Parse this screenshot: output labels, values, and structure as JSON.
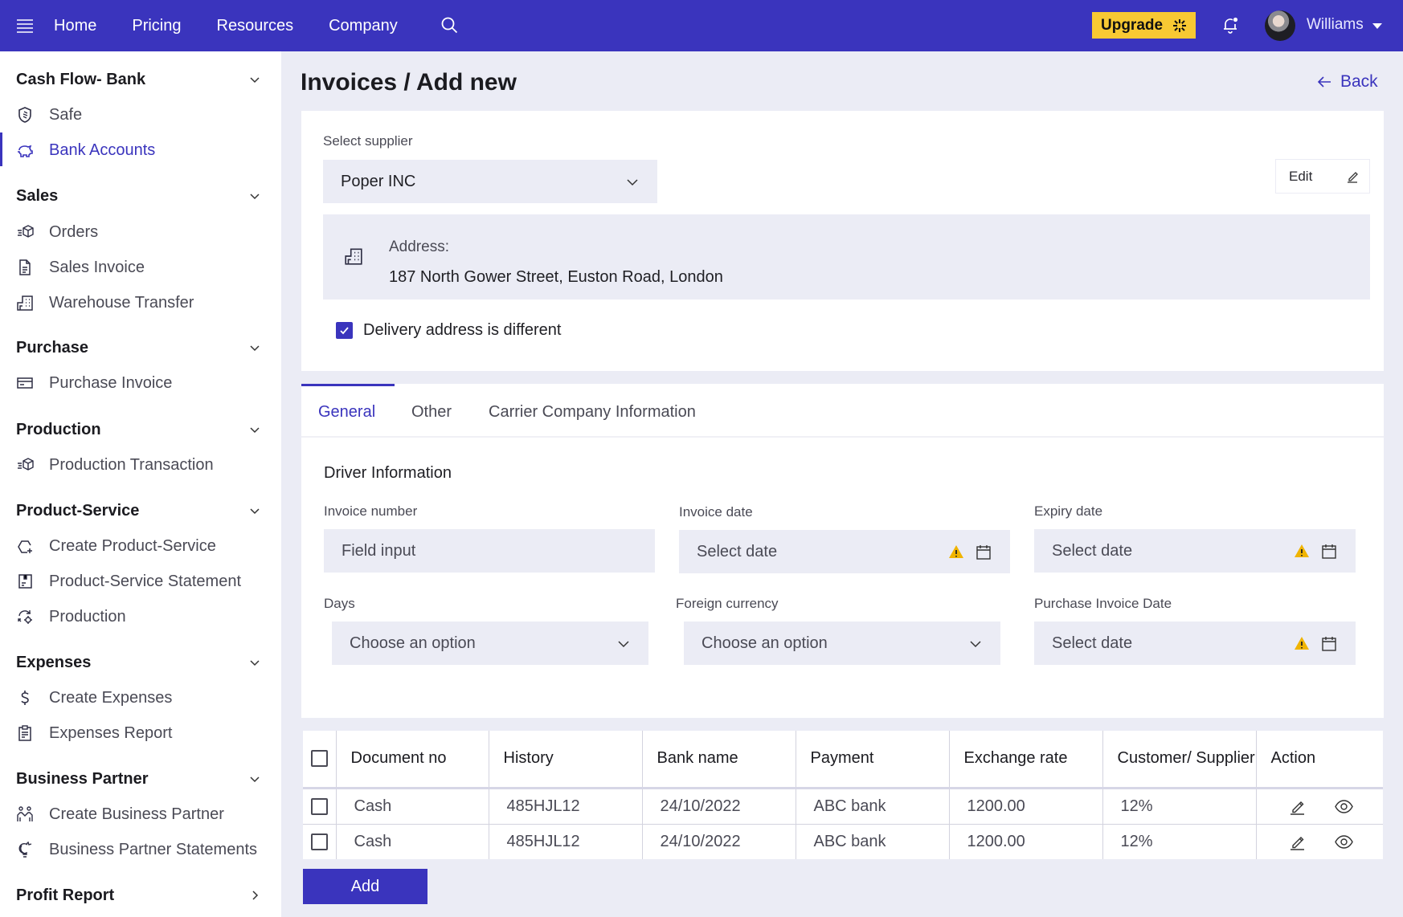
{
  "topbar": {
    "nav": [
      "Home",
      "Pricing",
      "Resources",
      "Company"
    ],
    "upgrade_label": "Upgrade",
    "user_name": "Williams"
  },
  "sidebar": {
    "sections": [
      {
        "title": "Cash Flow- Bank",
        "items": [
          {
            "label": "Safe",
            "icon": "shield-icon"
          },
          {
            "label": "Bank Accounts",
            "icon": "piggy-bank-icon",
            "active": true
          }
        ]
      },
      {
        "title": "Sales",
        "items": [
          {
            "label": "Orders",
            "icon": "fast-box-icon"
          },
          {
            "label": "Sales Invoice",
            "icon": "document-icon"
          },
          {
            "label": "Warehouse Transfer",
            "icon": "building-icon"
          }
        ]
      },
      {
        "title": "Purchase",
        "items": [
          {
            "label": "Purchase Invoice",
            "icon": "credit-card-icon"
          }
        ]
      },
      {
        "title": "Production",
        "items": [
          {
            "label": "Production Transaction",
            "icon": "fast-box-icon"
          }
        ]
      },
      {
        "title": "Product-Service",
        "items": [
          {
            "label": "Create Product-Service",
            "icon": "hexagon-plus-icon"
          },
          {
            "label": "Product-Service Statement",
            "icon": "statement-icon"
          },
          {
            "label": "Production",
            "icon": "refresh-gear-icon"
          }
        ]
      },
      {
        "title": "Expenses",
        "items": [
          {
            "label": "Create Expenses",
            "icon": "dollar-icon"
          },
          {
            "label": "Expenses Report",
            "icon": "clipboard-icon"
          }
        ]
      },
      {
        "title": "Business Partner",
        "items": [
          {
            "label": "Create Business Partner",
            "icon": "people-icon"
          },
          {
            "label": "Business Partner Statements",
            "icon": "lightbulb-icon"
          }
        ]
      },
      {
        "title": "Profit Report",
        "items": [],
        "collapsed": true
      }
    ]
  },
  "page": {
    "title": "Invoices / Add new",
    "back_label": "Back"
  },
  "supplier": {
    "label": "Select supplier",
    "value": "Poper INC",
    "edit_label": "Edit",
    "address_label": "Address:",
    "address_value": "187 North Gower Street, Euston Road, London",
    "delivery_checkbox_label": "Delivery address is different",
    "delivery_checked": true
  },
  "tabs": {
    "items": [
      "General",
      "Other",
      "Carrier Company Information"
    ],
    "active": "General"
  },
  "form": {
    "section_title": "Driver Information",
    "invoice_number": {
      "label": "Invoice number",
      "placeholder": "Field input"
    },
    "invoice_date": {
      "label": "Invoice date",
      "placeholder": "Select date"
    },
    "expiry_date": {
      "label": "Expiry date",
      "placeholder": "Select date"
    },
    "days": {
      "label": "Days",
      "placeholder": "Choose an option"
    },
    "foreign_currency": {
      "label": "Foreign currency",
      "placeholder": "Choose an option"
    },
    "purchase_invoice_date": {
      "label": "Purchase Invoice Date",
      "placeholder": "Select date"
    }
  },
  "table": {
    "columns": [
      "Document no",
      "History",
      "Bank name",
      "Payment",
      "Exchange rate",
      "Customer/ Supplier",
      "Action"
    ],
    "rows": [
      [
        "Cash",
        "485HJL12",
        "24/10/2022",
        "ABC bank",
        "1200.00",
        "12%"
      ],
      [
        "Cash",
        "485HJL12",
        "24/10/2022",
        "ABC bank",
        "1200.00",
        "12%"
      ]
    ],
    "add_label": "Add"
  },
  "colors": {
    "brand": "#3a34bd",
    "upgrade": "#f8c933",
    "warning": "#f0b400",
    "background": "#ebecf5"
  }
}
